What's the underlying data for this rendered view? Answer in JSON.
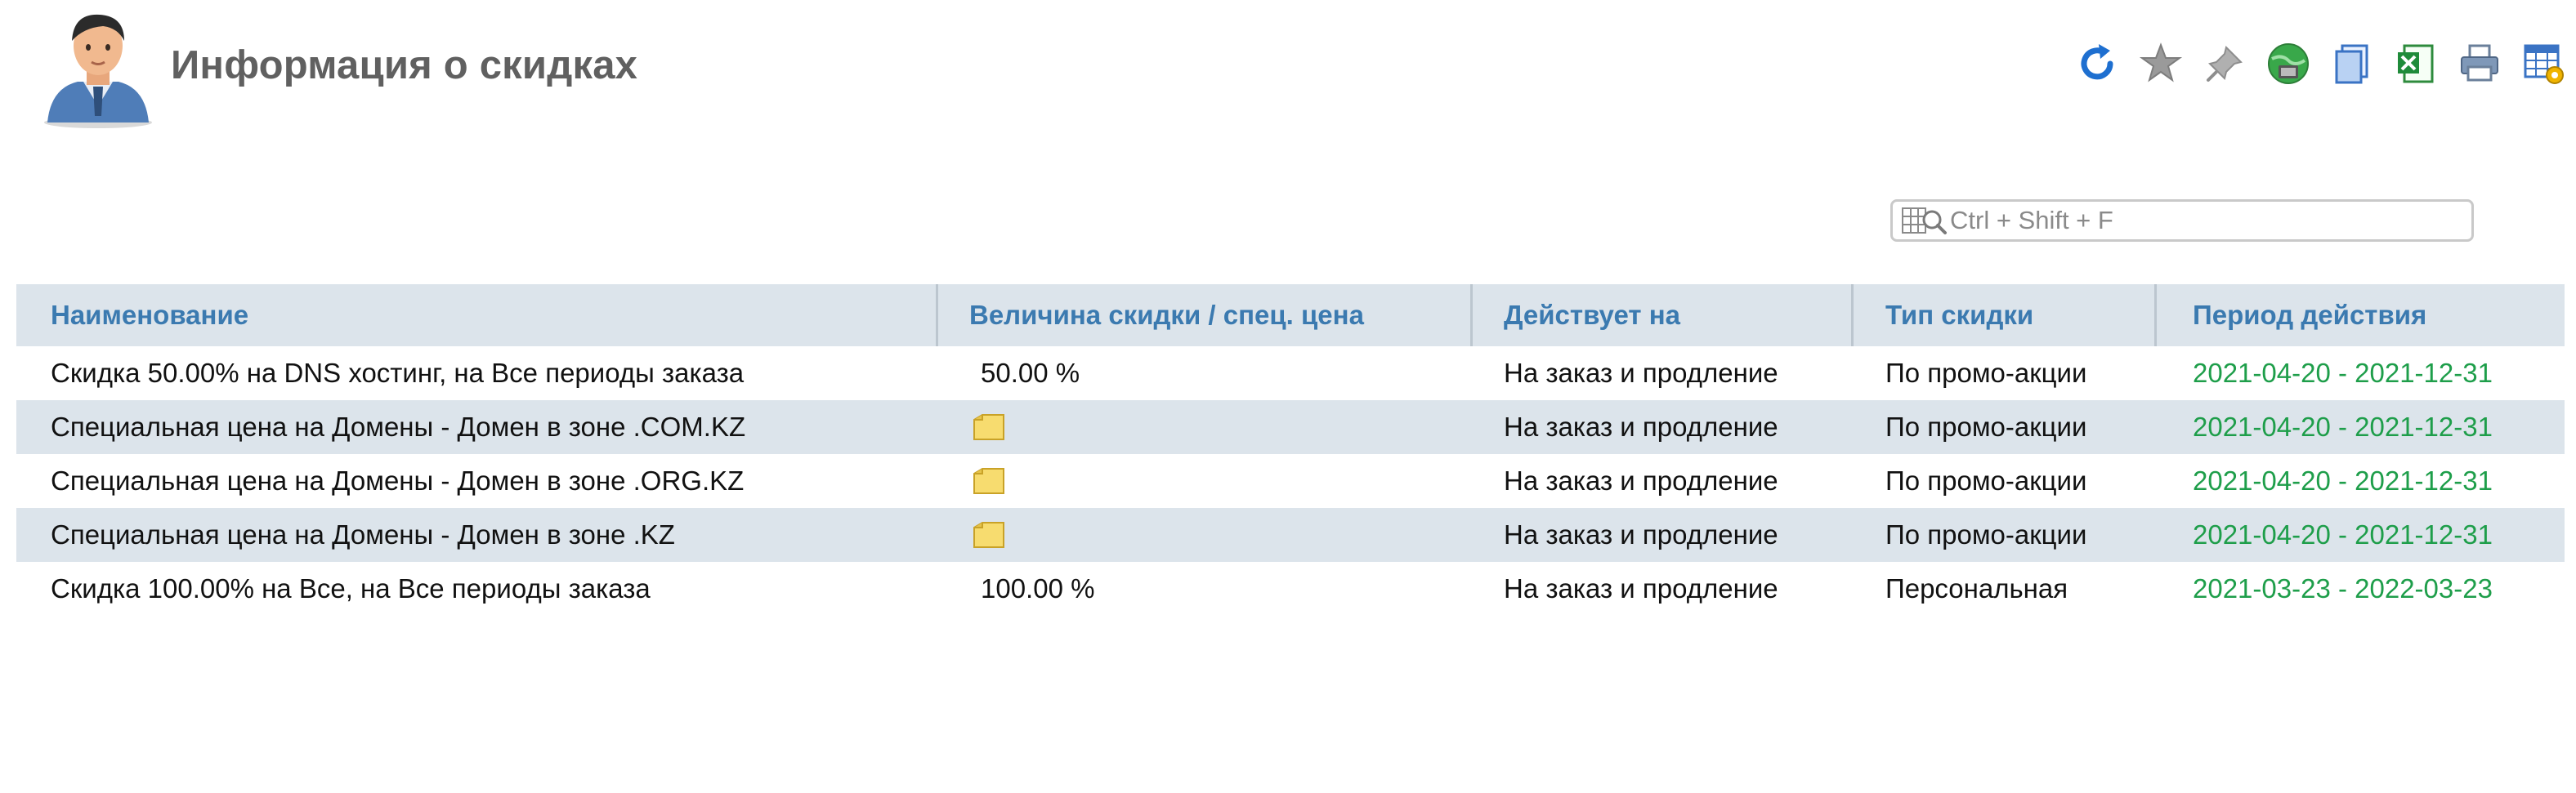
{
  "header": {
    "title": "Информация о скидках",
    "toolbar": [
      {
        "icon": "refresh-icon"
      },
      {
        "icon": "star-icon"
      },
      {
        "icon": "pin-icon"
      },
      {
        "icon": "network-icon"
      },
      {
        "icon": "copy-icon"
      },
      {
        "icon": "excel-icon"
      },
      {
        "icon": "print-icon"
      },
      {
        "icon": "table-settings-icon"
      }
    ]
  },
  "search": {
    "placeholder": "Ctrl + Shift + F"
  },
  "table": {
    "columns": [
      "Наименование",
      "Величина скидки / спец. цена",
      "Действует на",
      "Тип скидки",
      "Период действия"
    ],
    "rows": [
      {
        "name": "Скидка 50.00% на DNS хостинг, на Все периоды заказа",
        "value": "50.00 %",
        "applies": "На заказ и продление",
        "type": "По промо-акции",
        "period": "2021-04-20 - 2021-12-31"
      },
      {
        "name": "Специальная цена на Домены - Домен в зоне .COM.KZ",
        "value": "",
        "value_icon": "note-icon",
        "applies": "На заказ и продление",
        "type": "По промо-акции",
        "period": "2021-04-20 - 2021-12-31"
      },
      {
        "name": "Специальная цена на Домены - Домен в зоне .ORG.KZ",
        "value": "",
        "value_icon": "note-icon",
        "applies": "На заказ и продление",
        "type": "По промо-акции",
        "period": "2021-04-20 - 2021-12-31"
      },
      {
        "name": "Специальная цена на Домены - Домен в зоне .KZ",
        "value": "",
        "value_icon": "note-icon",
        "applies": "На заказ и продление",
        "type": "По промо-акции",
        "period": "2021-04-20 - 2021-12-31"
      },
      {
        "name": "Скидка 100.00% на Все, на Все периоды заказа",
        "value": "100.00 %",
        "applies": "На заказ и продление",
        "type": "Персональная",
        "period": "2021-03-23 - 2022-03-23"
      }
    ]
  },
  "colors": {
    "header_text": "#3b7ab0",
    "stripe": "#dce4eb",
    "period_text": "#1e9e4a",
    "title_text": "#606060"
  }
}
